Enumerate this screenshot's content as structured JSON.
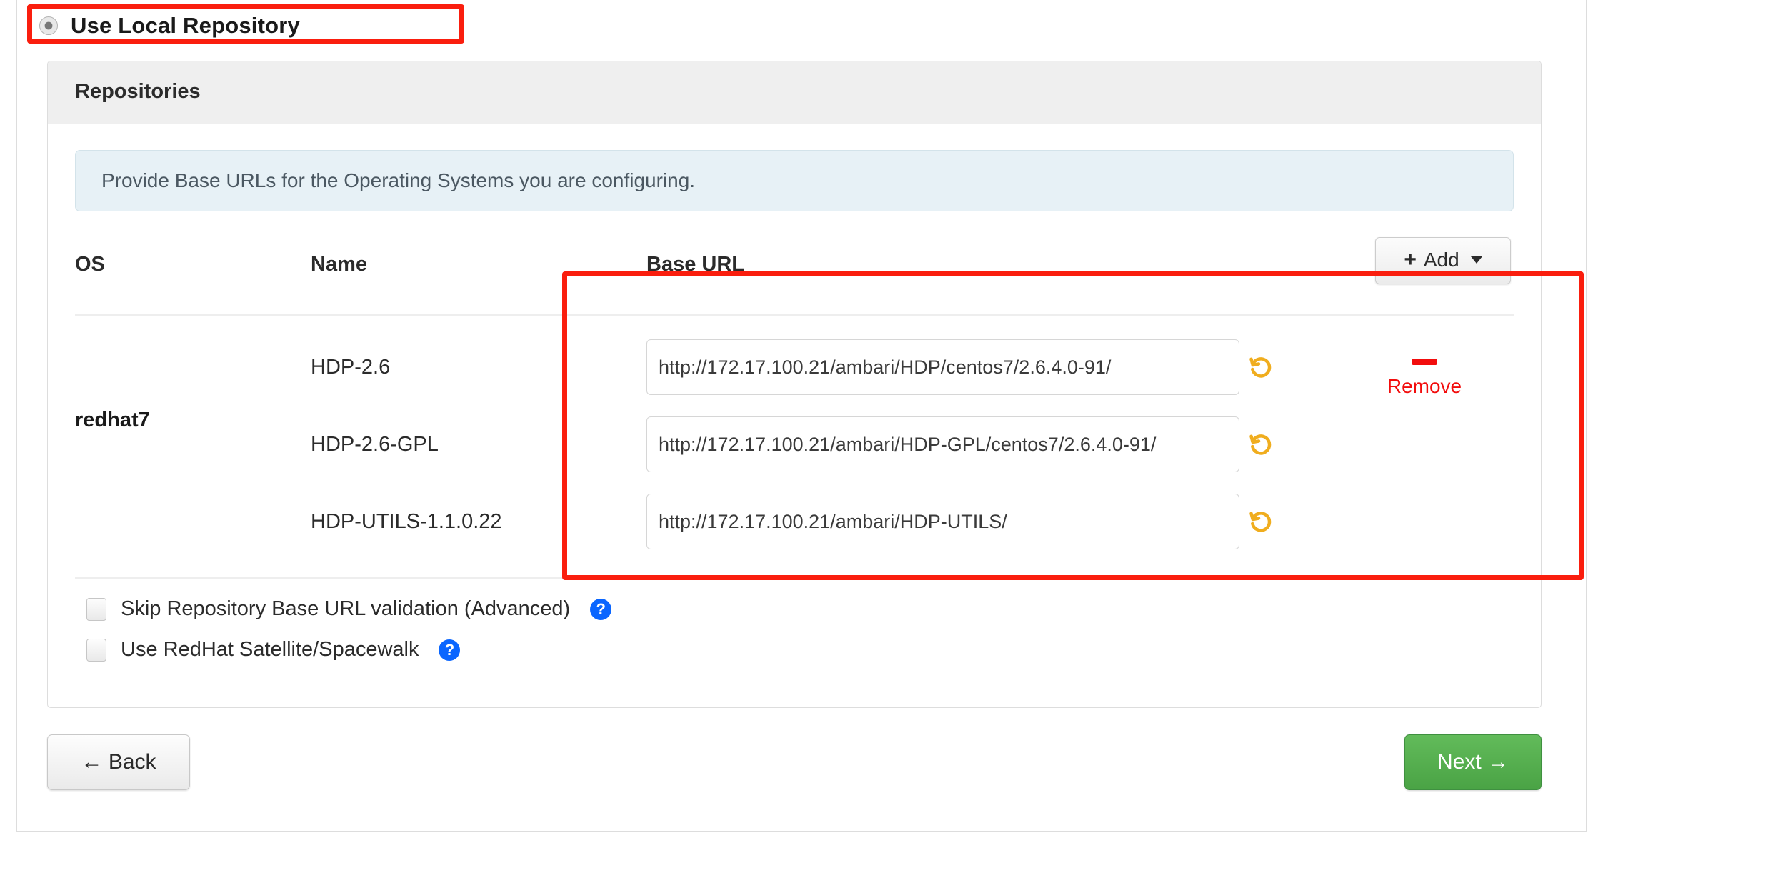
{
  "repo_option": {
    "label": "Use Local Repository",
    "selected": true,
    "radio_icon": "radio-selected-icon"
  },
  "panel": {
    "title": "Repositories",
    "info_banner": "Provide Base URLs for the Operating Systems you are configuring."
  },
  "table": {
    "headers": {
      "os": "OS",
      "name": "Name",
      "base_url": "Base URL"
    },
    "add_button": {
      "label": "Add",
      "plus_icon": "plus-icon",
      "caret_icon": "chevron-down-icon"
    },
    "os": "redhat7",
    "rows": [
      {
        "name": "HDP-2.6",
        "base_url": "http://172.17.100.21/ambari/HDP/centos7/2.6.4.0-91/",
        "reset_icon": "undo-reset-icon"
      },
      {
        "name": "HDP-2.6-GPL",
        "base_url": "http://172.17.100.21/ambari/HDP-GPL/centos7/2.6.4.0-91/",
        "reset_icon": "undo-reset-icon"
      },
      {
        "name": "HDP-UTILS-1.1.0.22",
        "base_url": "http://172.17.100.21/ambari/HDP-UTILS/",
        "reset_icon": "undo-reset-icon"
      }
    ],
    "remove": {
      "label": "Remove",
      "minus_icon": "minus-icon"
    }
  },
  "checkboxes": [
    {
      "label": "Skip Repository Base URL validation (Advanced)",
      "checked": false,
      "help_icon": "help-circle-icon",
      "help_glyph": "?"
    },
    {
      "label": "Use RedHat Satellite/Spacewalk",
      "checked": false,
      "help_icon": "help-circle-icon",
      "help_glyph": "?"
    }
  ],
  "footer": {
    "back_label": "← Back",
    "next_label": "Next →"
  },
  "colors": {
    "annotation_red": "#fa1e0e",
    "remove_red": "#f20d0d",
    "reset_amber": "#f0ad1e",
    "help_blue": "#0a66ff",
    "next_green": "#4aa345",
    "banner_blue": "#e7f1f6",
    "panel_header_gray": "#efefef"
  }
}
